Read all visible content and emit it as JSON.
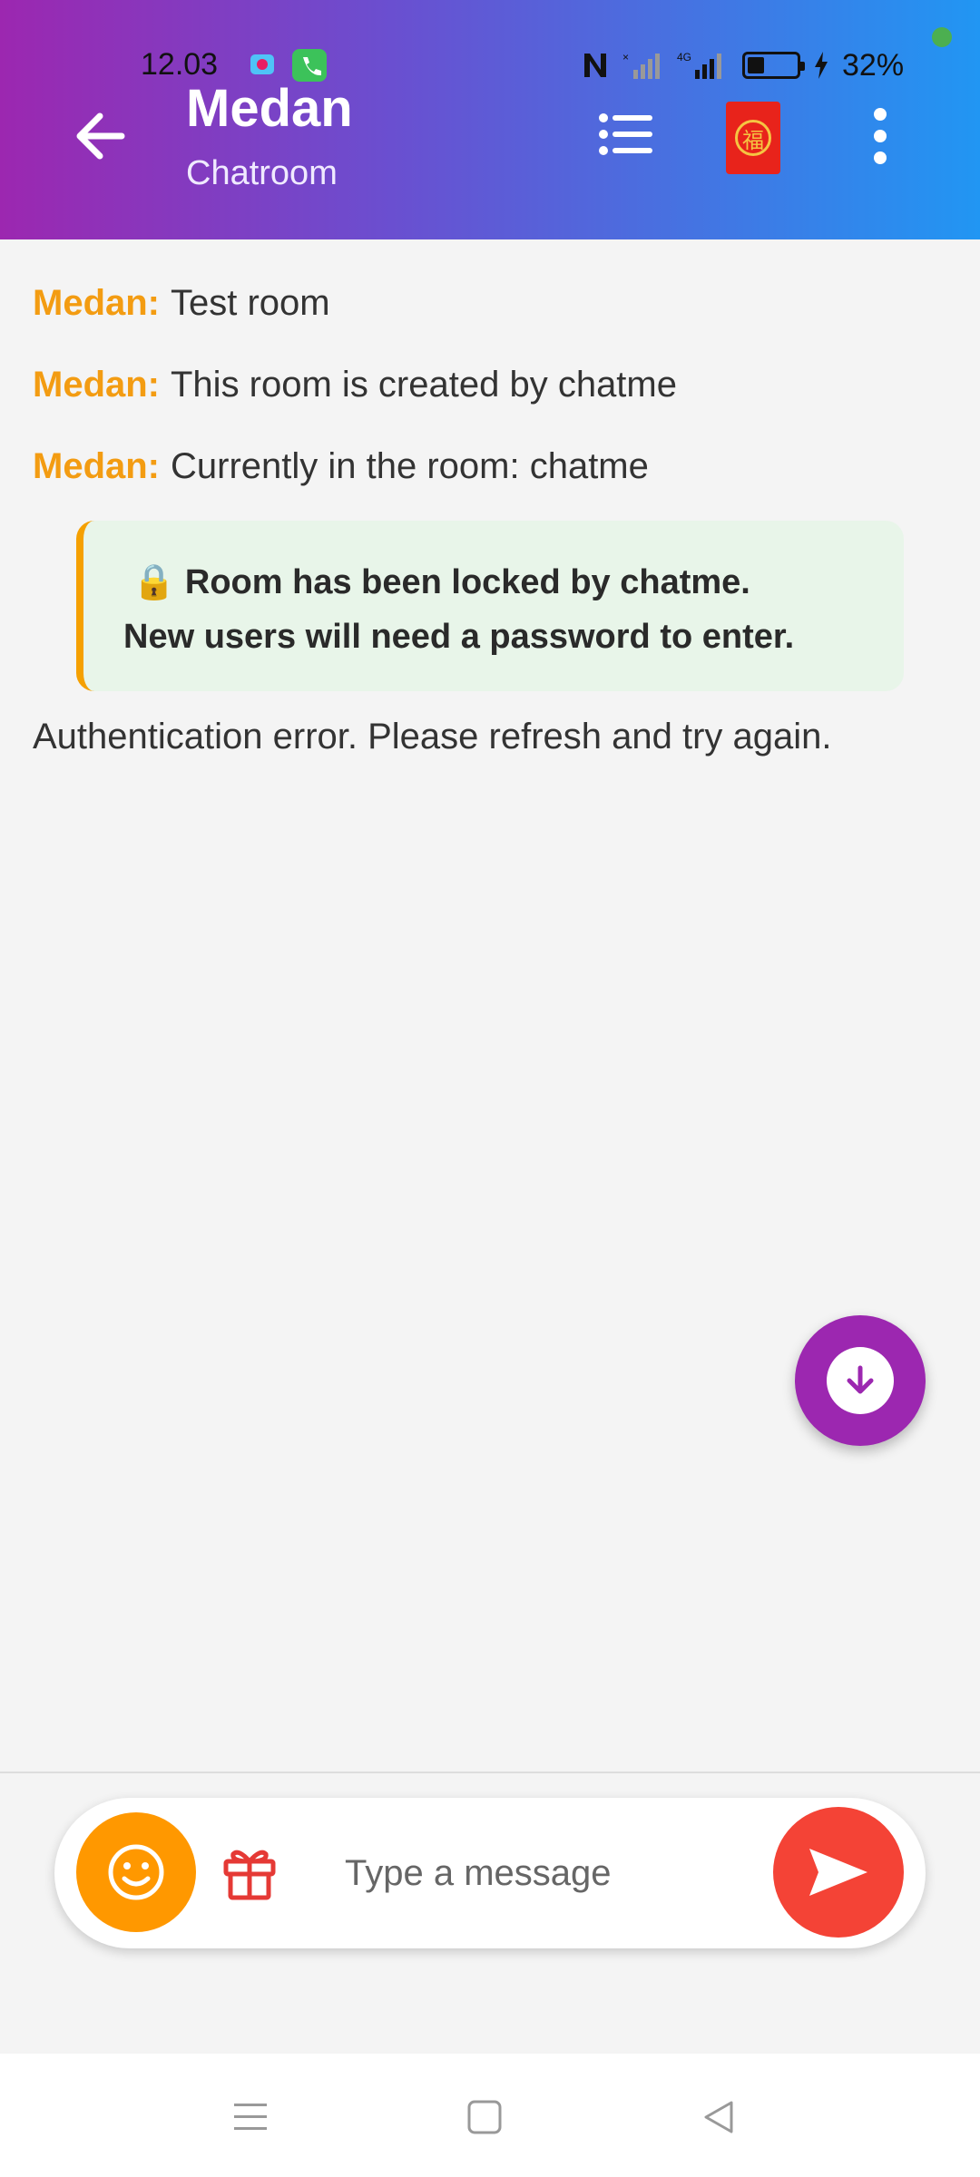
{
  "status_bar": {
    "time": "12.03",
    "battery": "32%",
    "network": "4G"
  },
  "header": {
    "title": "Medan",
    "subtitle": "Chatroom",
    "back_icon": "arrow-left-icon",
    "list_icon": "list-icon",
    "redpacket_icon": "red-envelope-icon",
    "redpacket_glyph": "福",
    "more_icon": "more-vertical-icon"
  },
  "messages": [
    {
      "sender": "Medan:",
      "text": "Test room"
    },
    {
      "sender": "Medan:",
      "text": "This room is created by chatme"
    },
    {
      "sender": "Medan:",
      "text": "Currently in the room: chatme"
    }
  ],
  "notice": {
    "icon": "🔒",
    "line1": "Room has been locked by chatme.",
    "line2": "New users will need a password to enter."
  },
  "error_message": "Authentication error. Please refresh and try again.",
  "composer": {
    "placeholder": "Type a message"
  },
  "colors": {
    "header_start": "#9c27b0",
    "header_end": "#2196f3",
    "sender": "#f39c12",
    "fab": "#9c27b0",
    "emoji_button": "#ff9800",
    "send_button": "#f44336",
    "notice_bg": "#e8f5e9",
    "notice_border": "#f5a000"
  }
}
